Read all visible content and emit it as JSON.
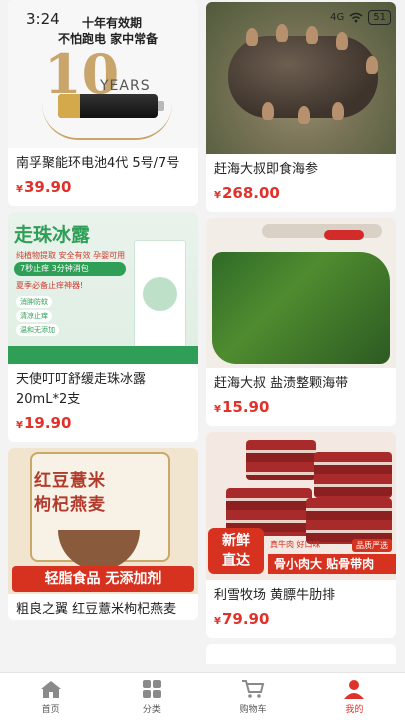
{
  "status": {
    "time": "3:24",
    "network": "4G",
    "battery": "51"
  },
  "products": [
    {
      "title": "南孚聚能环电池4代 5号/7号",
      "currency": "¥",
      "price": "39.90",
      "image": {
        "line1": "十年有效期",
        "line2": "不怕跑电 家中常备",
        "big": "10",
        "years": "YEARS"
      }
    },
    {
      "title": "赶海大叔即食海参",
      "currency": "¥",
      "price": "268.00"
    },
    {
      "title": "天使叮叮舒缓走珠冰露20mL*2支",
      "currency": "¥",
      "price": "19.90",
      "image": {
        "headline": "走珠冰露",
        "sub": "纯植物提取 安全有效 孕婴可用",
        "bar": "7秒止痒 3分钟消包",
        "note": "夏季必备止痒神器!",
        "tags": [
          "消肿防蚊",
          "清凉止痒",
          "温和无添加"
        ]
      }
    },
    {
      "title": "赶海大叔 盐渍整颗海带",
      "currency": "¥",
      "price": "15.90"
    },
    {
      "title": "粗良之翼 红豆薏米枸杞燕麦",
      "currency": "¥",
      "price": "",
      "image": {
        "line1": "红豆薏米",
        "line2": "枸杞燕麦",
        "band": "轻脂食品 无添加剂"
      }
    },
    {
      "title": "利雪牧场 黄膘牛肋排",
      "currency": "¥",
      "price": "79.90",
      "image": {
        "badge_line1": "新鲜",
        "badge_line2": "直达",
        "band": "骨小肉大 贴骨带肉",
        "note": "真牛肉 好口味",
        "tag": "品质严选"
      }
    }
  ],
  "tabs": [
    {
      "label": "首页",
      "icon": "home-icon"
    },
    {
      "label": "分类",
      "icon": "grid-icon"
    },
    {
      "label": "购物车",
      "icon": "cart-icon"
    },
    {
      "label": "我的",
      "icon": "user-icon",
      "active": true
    }
  ],
  "colors": {
    "accent": "#e0322a",
    "tab_inactive": "#555555",
    "background": "#f3f3f3"
  }
}
